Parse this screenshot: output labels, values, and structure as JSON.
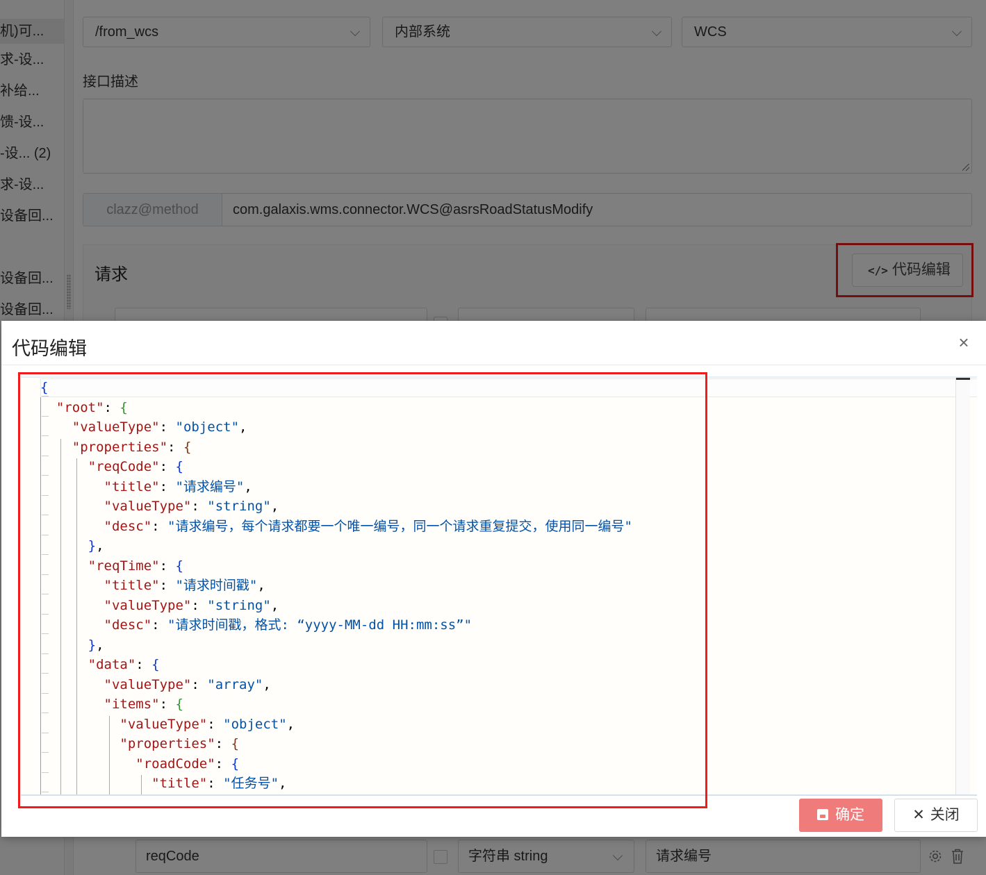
{
  "sidebar": {
    "items": [
      {
        "label": "机)可..."
      },
      {
        "label": "求-设..."
      },
      {
        "label": "补给..."
      },
      {
        "label": "馈-设..."
      },
      {
        "label": "-设... (2)"
      },
      {
        "label": "求-设..."
      },
      {
        "label": "设备回..."
      },
      {
        "label": "设备回..."
      },
      {
        "label": "设备回..."
      }
    ]
  },
  "form": {
    "path_select": "/from_wcs",
    "system_select": "内部系统",
    "module_select": "WCS",
    "desc_label": "接口描述",
    "desc_value": "",
    "clazz_label": "clazz@method",
    "clazz_value": "com.galaxis.wms.connector.WCS@asrsRoadStatusModify"
  },
  "request_panel": {
    "title": "请求",
    "code_edit_button": "代码编辑"
  },
  "background_row": {
    "field_name": "reqCode",
    "field_type": "字符串 string",
    "field_desc": "请求编号"
  },
  "modal": {
    "title": "代码编辑",
    "close_icon": "close-icon",
    "ok_label": "确定",
    "cancel_label": "关闭",
    "code_lines": [
      [
        {
          "t": "{",
          "c": "b1"
        }
      ],
      [
        {
          "t": "  "
        },
        {
          "t": "\"root\"",
          "c": "k"
        },
        {
          "t": ": "
        },
        {
          "t": "{",
          "c": "b2"
        }
      ],
      [
        {
          "t": "    "
        },
        {
          "t": "\"valueType\"",
          "c": "k"
        },
        {
          "t": ": "
        },
        {
          "t": "\"object\"",
          "c": "s"
        },
        {
          "t": ","
        }
      ],
      [
        {
          "t": "    "
        },
        {
          "t": "\"properties\"",
          "c": "k"
        },
        {
          "t": ": "
        },
        {
          "t": "{",
          "c": "b3"
        }
      ],
      [
        {
          "t": "      "
        },
        {
          "t": "\"reqCode\"",
          "c": "k"
        },
        {
          "t": ": "
        },
        {
          "t": "{",
          "c": "b1"
        }
      ],
      [
        {
          "t": "        "
        },
        {
          "t": "\"title\"",
          "c": "k"
        },
        {
          "t": ": "
        },
        {
          "t": "\"请求编号\"",
          "c": "s"
        },
        {
          "t": ","
        }
      ],
      [
        {
          "t": "        "
        },
        {
          "t": "\"valueType\"",
          "c": "k"
        },
        {
          "t": ": "
        },
        {
          "t": "\"string\"",
          "c": "s"
        },
        {
          "t": ","
        }
      ],
      [
        {
          "t": "        "
        },
        {
          "t": "\"desc\"",
          "c": "k"
        },
        {
          "t": ": "
        },
        {
          "t": "\"请求编号，每个请求都要一个唯一编号，同一个请求重复提交，使用同一编号\"",
          "c": "s"
        }
      ],
      [
        {
          "t": "      "
        },
        {
          "t": "}",
          "c": "b1"
        },
        {
          "t": ","
        }
      ],
      [
        {
          "t": "      "
        },
        {
          "t": "\"reqTime\"",
          "c": "k"
        },
        {
          "t": ": "
        },
        {
          "t": "{",
          "c": "b1"
        }
      ],
      [
        {
          "t": "        "
        },
        {
          "t": "\"title\"",
          "c": "k"
        },
        {
          "t": ": "
        },
        {
          "t": "\"请求时间戳\"",
          "c": "s"
        },
        {
          "t": ","
        }
      ],
      [
        {
          "t": "        "
        },
        {
          "t": "\"valueType\"",
          "c": "k"
        },
        {
          "t": ": "
        },
        {
          "t": "\"string\"",
          "c": "s"
        },
        {
          "t": ","
        }
      ],
      [
        {
          "t": "        "
        },
        {
          "t": "\"desc\"",
          "c": "k"
        },
        {
          "t": ": "
        },
        {
          "t": "\"请求时间戳，格式: “yyyy-MM-dd HH:mm:ss”\"",
          "c": "s"
        }
      ],
      [
        {
          "t": "      "
        },
        {
          "t": "}",
          "c": "b1"
        },
        {
          "t": ","
        }
      ],
      [
        {
          "t": "      "
        },
        {
          "t": "\"data\"",
          "c": "k"
        },
        {
          "t": ": "
        },
        {
          "t": "{",
          "c": "b1"
        }
      ],
      [
        {
          "t": "        "
        },
        {
          "t": "\"valueType\"",
          "c": "k"
        },
        {
          "t": ": "
        },
        {
          "t": "\"array\"",
          "c": "s"
        },
        {
          "t": ","
        }
      ],
      [
        {
          "t": "        "
        },
        {
          "t": "\"items\"",
          "c": "k"
        },
        {
          "t": ": "
        },
        {
          "t": "{",
          "c": "b2"
        }
      ],
      [
        {
          "t": "          "
        },
        {
          "t": "\"valueType\"",
          "c": "k"
        },
        {
          "t": ": "
        },
        {
          "t": "\"object\"",
          "c": "s"
        },
        {
          "t": ","
        }
      ],
      [
        {
          "t": "          "
        },
        {
          "t": "\"properties\"",
          "c": "k"
        },
        {
          "t": ": "
        },
        {
          "t": "{",
          "c": "b3"
        }
      ],
      [
        {
          "t": "            "
        },
        {
          "t": "\"roadCode\"",
          "c": "k"
        },
        {
          "t": ": "
        },
        {
          "t": "{",
          "c": "b1"
        }
      ],
      [
        {
          "t": "              "
        },
        {
          "t": "\"title\"",
          "c": "k"
        },
        {
          "t": ": "
        },
        {
          "t": "\"任务号\"",
          "c": "s"
        },
        {
          "t": ","
        }
      ]
    ]
  },
  "colors": {
    "highlight_border": "#f01b1b",
    "ok_button": "#ef7b7b",
    "json_key": "#a31515",
    "json_string": "#0451a5"
  }
}
